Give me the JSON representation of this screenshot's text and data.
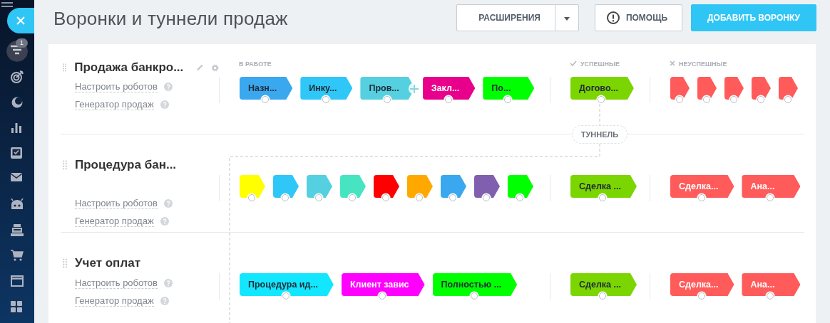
{
  "sidebar": {
    "items": [
      {
        "kind": "menu",
        "selected": false
      },
      {
        "kind": "funnel",
        "selected": true,
        "badge": "1"
      },
      {
        "kind": "target",
        "selected": false
      },
      {
        "kind": "moon",
        "selected": false
      },
      {
        "kind": "chart",
        "selected": false
      },
      {
        "kind": "task",
        "selected": false
      },
      {
        "kind": "mail",
        "selected": false
      },
      {
        "kind": "robot",
        "selected": false
      },
      {
        "kind": "register",
        "selected": false
      },
      {
        "kind": "cart",
        "selected": false
      },
      {
        "kind": "window",
        "selected": false
      },
      {
        "kind": "grid",
        "selected": false
      }
    ]
  },
  "header": {
    "title": "Воронки и туннели продаж",
    "buttons": [
      {
        "kind": "split",
        "label": "РАСШИРЕНИЯ"
      },
      {
        "kind": "help",
        "label": "ПОМОЩЬ"
      },
      {
        "kind": "primary",
        "label": "ДОБАВИТЬ ВОРОНКУ"
      }
    ]
  },
  "tunnel": {
    "label": "ТУННЕЛЬ"
  },
  "pipelines": [
    {
      "title": "Продажа банкро...",
      "editable": true,
      "column_headings": {
        "in_work": "В РАБОТЕ",
        "success": "УСПЕШНЫЕ",
        "fail": "НЕУСПЕШНЫЕ"
      },
      "links": [
        "Настроить роботов",
        "Генератор продаж"
      ],
      "in_work": [
        {
          "label": "Назн...",
          "color": "#39a8ef",
          "hover": false
        },
        {
          "label": "Инку...",
          "color": "#2fc7f7",
          "hover": false
        },
        {
          "label": "Пров...",
          "color": "#55d0e0",
          "hover": true
        },
        {
          "label": "Закл...",
          "color": "#e8008c",
          "hover": false
        },
        {
          "label": "По...",
          "color": "#00ff00",
          "hover": false
        }
      ],
      "success": [
        {
          "label": "Догово...",
          "color": "#7bd500",
          "hover": false
        }
      ],
      "fail": [
        {
          "color": "#ff5b5b",
          "hover": false
        },
        {
          "color": "#ff5b5b",
          "hover": false
        },
        {
          "color": "#ff5b5b",
          "hover": false
        },
        {
          "color": "#ff5b5b",
          "hover": false
        },
        {
          "color": "#ff5b5b",
          "hover": false
        }
      ]
    },
    {
      "title": "Процедура бан...",
      "links": [
        "Настроить роботов",
        "Генератор продаж"
      ],
      "in_work": [
        {
          "color": "#ffff00",
          "hover": false
        },
        {
          "color": "#2fc7f7",
          "hover": false
        },
        {
          "color": "#55d0e0",
          "hover": false
        },
        {
          "color": "#47e4c2",
          "hover": false
        },
        {
          "color": "#ff0000",
          "hover": false
        },
        {
          "color": "#ffa900",
          "hover": false
        },
        {
          "color": "#39a8ef",
          "hover": false
        },
        {
          "color": "#8060ae",
          "hover": false
        },
        {
          "color": "#00ff00",
          "hover": false
        }
      ],
      "success": [
        {
          "label": "Сделка ...",
          "color": "#7bd500",
          "hover": false
        }
      ],
      "fail": [
        {
          "label": "Сделка...",
          "color": "#ff5b5b",
          "hover": false
        },
        {
          "label": "Ана...",
          "color": "#ff5b5b",
          "hover": false
        }
      ]
    },
    {
      "title": "Учет оплат",
      "links": [
        "Настроить роботов",
        "Генератор продаж"
      ],
      "in_work": [
        {
          "label": "Процедура ид...",
          "color": "#12e7ff",
          "hover": false
        },
        {
          "label": "Клиент завис",
          "color": "#ff00ff",
          "hover": false
        },
        {
          "label": "Полностью ...",
          "color": "#00ff00",
          "hover": false
        }
      ],
      "success": [
        {
          "label": "Сделка ...",
          "color": "#7bd500",
          "hover": false
        }
      ],
      "fail": [
        {
          "label": "Сделка...",
          "color": "#ff5b5b",
          "hover": false
        },
        {
          "label": "Ана...",
          "color": "#ff5b5b",
          "hover": false
        }
      ]
    }
  ]
}
